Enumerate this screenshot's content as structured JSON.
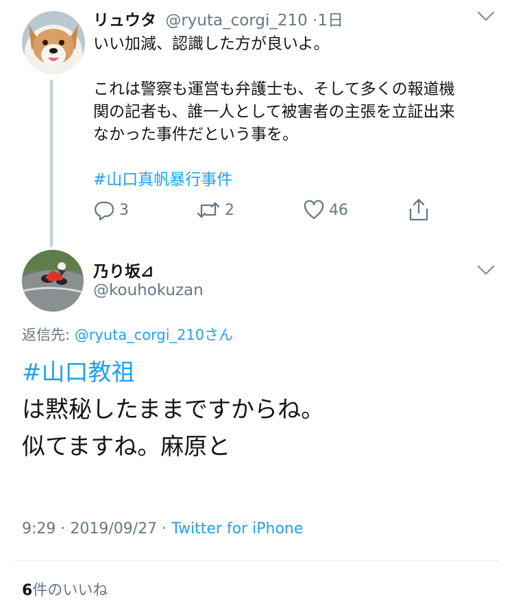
{
  "tweet1": {
    "display_name": "リュウタ",
    "handle": "@ryuta_corgi_210",
    "time": "·1日",
    "line1": "いい加減、認識した方が良いよ。",
    "para2_line1": "これは警察も運営も弁護士も、そして多くの報道機",
    "para2_line2": "関の記者も、誰一人として被害者の主張を立証出来",
    "para2_line3": "なかった事件だという事を。",
    "hashtag": "#山口真帆暴行事件",
    "reply_count": "3",
    "retweet_count": "2",
    "like_count": "46"
  },
  "tweet2": {
    "display_name": "乃り坂⊿",
    "handle": "@kouhokuzan",
    "reply_to_label": "返信先: ",
    "reply_to_handle": "@ryuta_corgi_210",
    "reply_to_suffix": "さん",
    "hashtag": "#山口教祖",
    "line1": "は黙秘したままですからね。",
    "line2": "似てますね。麻原と",
    "timestamp": "9:29 · 2019/09/27 · ",
    "source": "Twitter for iPhone",
    "likes_count": "6",
    "likes_label": "件のいいね"
  },
  "icons": {
    "reply": "reply-icon",
    "retweet": "retweet-icon",
    "like": "heart-icon",
    "share": "share-icon",
    "more": "chevron-down-icon"
  },
  "colors": {
    "accent": "#1da1f2",
    "muted": "#657786",
    "text": "#14171a"
  }
}
